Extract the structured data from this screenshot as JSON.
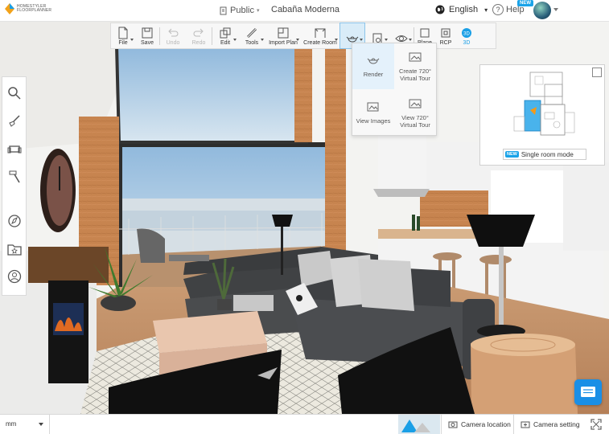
{
  "app": {
    "logo_line1": "HOMESTYLER",
    "logo_line2": "FLOORPLANNER",
    "visibility": "Public",
    "project_title": "Cabaña Moderna",
    "language": "English",
    "help_label": "Help",
    "new_badge": "NEW"
  },
  "toolbar": {
    "items": [
      {
        "label": "File"
      },
      {
        "label": "Save"
      },
      {
        "label": "Undo"
      },
      {
        "label": "Redo"
      },
      {
        "label": "Edit"
      },
      {
        "label": "Tools"
      },
      {
        "label": "Import Plan"
      },
      {
        "label": "Create Room"
      },
      {
        "label": ""
      },
      {
        "label": ""
      },
      {
        "label": ""
      },
      {
        "label": "Plane"
      },
      {
        "label": "RCP"
      },
      {
        "label": "3D"
      }
    ]
  },
  "render_menu": {
    "items": [
      {
        "label": "Render"
      },
      {
        "label": "Create 720° Virtual Tour"
      },
      {
        "label": "View Images"
      },
      {
        "label": "View 720° Virtual Tour"
      }
    ]
  },
  "minimap": {
    "mode_badge": "NEW",
    "mode_label": "Single room mode"
  },
  "bottom": {
    "unit": "mm",
    "camera_location": "Camera location",
    "camera_setting": "Camera setting"
  },
  "colors": {
    "accent": "#1a9fe6",
    "toolbar_bg": "#f7f7f7",
    "active_tool_bg": "#d9ecf8"
  },
  "icons": {
    "sidebar": [
      "search-icon",
      "shovel-icon",
      "sofa-icon",
      "hammer-icon",
      "compass-icon",
      "folder-star-icon",
      "user-icon"
    ]
  }
}
